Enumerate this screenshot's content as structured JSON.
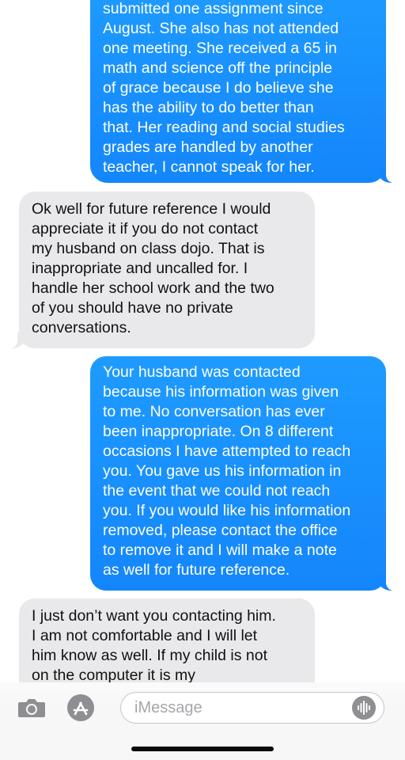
{
  "messages": [
    {
      "direction": "sent",
      "text": "submitted one assignment since\nAugust. She also has not attended\none meeting. She received a 65 in\nmath and science off the principle\nof grace because I do believe she\nhas the ability to do better than\nthat. Her reading and social studies\ngrades are handled by another\nteacher, I cannot speak for her."
    },
    {
      "direction": "received",
      "text": "Ok well for future reference I would\nappreciate it if you do not contact\nmy husband on class dojo. That is\ninappropriate and uncalled for. I\nhandle her school work and the two\nof you should have no private\nconversations."
    },
    {
      "direction": "sent",
      "text": "Your husband was contacted\nbecause his information was given\nto me. No conversation has ever\nbeen inappropriate. On 8 different\noccasions I have attempted to reach\nyou. You gave us his information in\nthe event that we could not reach\nyou. If you would like his information\nremoved, please contact the office\nto remove it and I will make a note\nas well for future reference."
    },
    {
      "direction": "received",
      "text": "I just don’t want you contacting him.\nI am not comfortable and I will let\nhim know as well. If my child is not\non the computer it is my"
    }
  ],
  "input_bar": {
    "placeholder": "iMessage",
    "camera_icon": "camera-icon",
    "apps_icon": "app-store-icon",
    "audio_icon": "audio-waveform-icon"
  },
  "colors": {
    "sent_bubble": "#1486fb",
    "received_bubble": "#e9e9eb",
    "icon_gray": "#8e8e93"
  }
}
